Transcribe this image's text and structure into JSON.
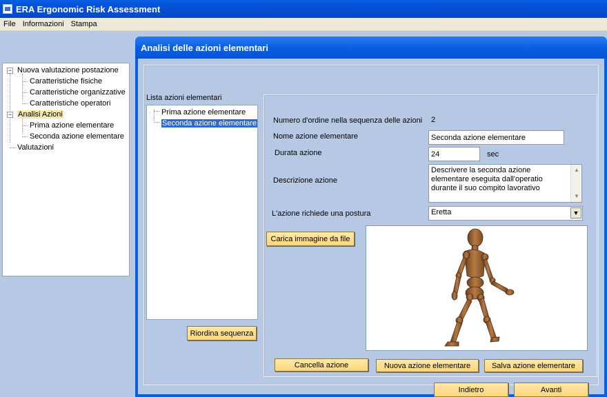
{
  "window": {
    "title": "ERA Ergonomic Risk Assessment"
  },
  "menu": [
    "File",
    "Informazioni",
    "Stampa"
  ],
  "tree": {
    "items": [
      {
        "label": "Nuova valutazione postazione",
        "level": 0,
        "expander": "⊟"
      },
      {
        "label": "Caratteristiche fisiche",
        "level": 1
      },
      {
        "label": "Caratteristiche organizzative",
        "level": 1
      },
      {
        "label": "Caratteristiche operatori",
        "level": 1
      },
      {
        "label": "Analisi Azioni",
        "level": 0,
        "expander": "⊟",
        "selected": true
      },
      {
        "label": "Prima azione elementare",
        "level": 1
      },
      {
        "label": "Seconda azione elementare",
        "level": 1
      },
      {
        "label": "Valutazioni",
        "level": 0
      }
    ]
  },
  "main": {
    "title": "Analisi delle azioni elementari",
    "list_label": "Lista azioni elementari",
    "list_items": [
      "Prima azione elementare",
      "Seconda azione elementare"
    ],
    "selected_index": 1,
    "reorder_button": "Riordina sequenza",
    "order_label": "Numero d'ordine nella sequenza delle azioni",
    "order_value": "2",
    "name_label": "Nome azione elementare",
    "name_value": "Seconda azione elementare",
    "duration_label": "Durata azione",
    "duration_value": "24",
    "duration_unit": "sec",
    "description_label": "Descrizione azione",
    "description_value": "Descrivere la seconda azione elementare eseguita dall'operatio durante il suo compito lavorativo",
    "posture_label": "L'azione richiede una postura",
    "posture_value": "Eretta",
    "load_image_button": "Carica immagine da file",
    "delete_button": "Cancella azione",
    "new_button": "Nuova azione elementare",
    "save_button": "Salva azione elementare",
    "back_button": "Indietro",
    "next_button": "Avanti"
  },
  "icons": [
    "app-icon",
    "expand-icon",
    "scroll-up-icon",
    "scroll-down-icon",
    "dropdown-arrow-icon"
  ]
}
